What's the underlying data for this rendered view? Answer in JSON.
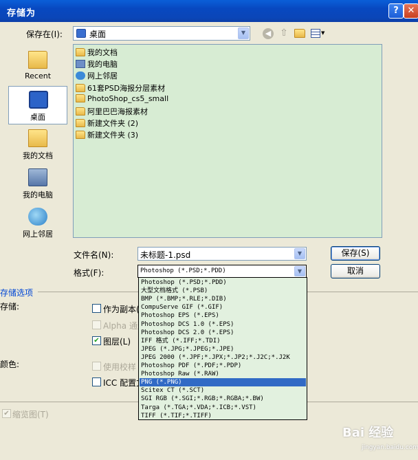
{
  "window": {
    "title": "存储为",
    "help_label": "?",
    "close_label": "✕"
  },
  "save_in": {
    "label": "保存在(I):",
    "value": "桌面"
  },
  "places": [
    {
      "label": "Recent"
    },
    {
      "label": "桌面"
    },
    {
      "label": "我的文档"
    },
    {
      "label": "我的电脑"
    },
    {
      "label": "网上邻居"
    }
  ],
  "files": [
    {
      "name": "我的文档",
      "icon": "documents-icon"
    },
    {
      "name": "我的电脑",
      "icon": "computer-icon"
    },
    {
      "name": "网上邻居",
      "icon": "network-icon"
    },
    {
      "name": "61套PSD海报分层素材",
      "icon": "folder-icon"
    },
    {
      "name": "PhotoShop_cs5_small",
      "icon": "folder-icon"
    },
    {
      "name": "阿里巴巴海报素材",
      "icon": "folder-icon"
    },
    {
      "name": "新建文件夹 (2)",
      "icon": "folder-icon"
    },
    {
      "name": "新建文件夹 (3)",
      "icon": "folder-icon"
    }
  ],
  "filename": {
    "label": "文件名(N):",
    "value": "未标题-1.psd"
  },
  "format": {
    "label": "格式(F):",
    "value": "Photoshop (*.PSD;*.PDD)",
    "options": [
      "Photoshop (*.PSD;*.PDD)",
      "大型文档格式 (*.PSB)",
      "BMP (*.BMP;*.RLE;*.DIB)",
      "CompuServe GIF (*.GIF)",
      "Photoshop EPS (*.EPS)",
      "Photoshop DCS 1.0 (*.EPS)",
      "Photoshop DCS 2.0 (*.EPS)",
      "IFF 格式 (*.IFF;*.TDI)",
      "JPEG (*.JPG;*.JPEG;*.JPE)",
      "JPEG 2000 (*.JPF;*.JPX;*.JP2;*.J2C;*.J2K",
      "Photoshop PDF (*.PDF;*.PDP)",
      "Photoshop Raw (*.RAW)",
      "PNG (*.PNG)",
      "Scitex CT (*.SCT)",
      "SGI RGB (*.SGI;*.RGB;*.RGBA;*.BW)",
      "Targa (*.TGA;*.VDA;*.ICB;*.VST)",
      "TIFF (*.TIF;*.TIFF)"
    ],
    "selected_index": 12
  },
  "buttons": {
    "save": "保存(S)",
    "cancel": "取消"
  },
  "options": {
    "section_label": "存储选项",
    "store_label": "存储:",
    "as_copy": "作为副本(",
    "alpha": "Alpha 通道",
    "layers": "图层(L)",
    "color_label": "颜色:",
    "proof": "使用校样",
    "icc": "ICC 配置文",
    "thumbnail": "缩览图(T)"
  },
  "watermark": {
    "text": "Bai 经验",
    "sub": "jingyan.baidu.com"
  },
  "colors": {
    "title_bar": "#0a5fd8",
    "selected": "#316ac5",
    "list_bg": "#d7ecd3"
  }
}
